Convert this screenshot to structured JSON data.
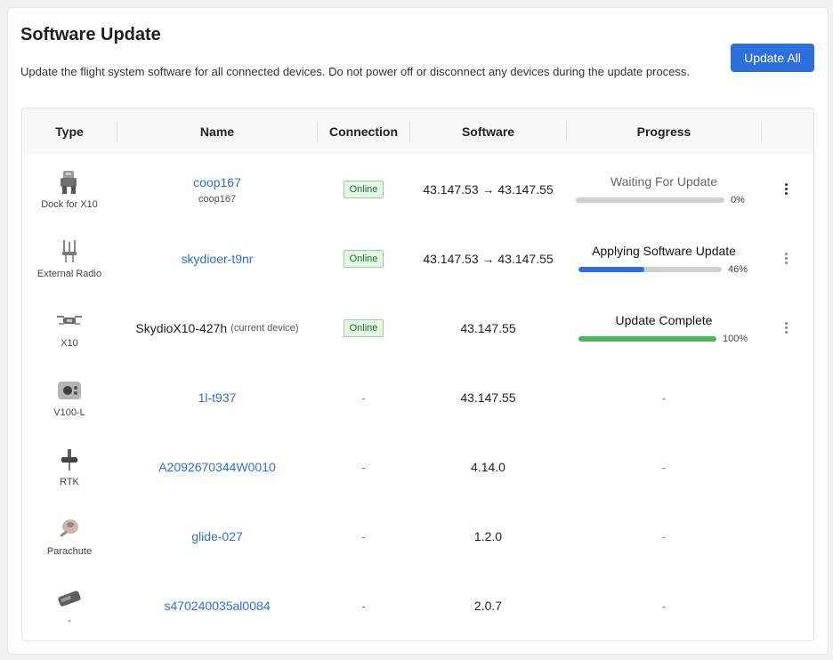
{
  "header": {
    "title": "Software Update",
    "description": "Update the flight system software for all connected devices. Do not power off or disconnect any devices during the update process.",
    "update_all_label": "Update All"
  },
  "columns": [
    "Type",
    "Name",
    "Connection",
    "Software",
    "Progress"
  ],
  "colors": {
    "accent": "#2e6fde",
    "progress_blue": "#2e6fde",
    "progress_green": "#4fb45c",
    "online_bg": "#e6f6e6"
  },
  "rows": [
    {
      "icon": "dock-icon",
      "type": "Dock for X10",
      "name": "coop167",
      "subname": "coop167",
      "connection": "Online",
      "software": "43.147.53 → 43.147.55",
      "progress": {
        "status": "Waiting For Update",
        "percent_label": "0%",
        "percent": 0
      }
    },
    {
      "icon": "radio-icon",
      "type": "External Radio",
      "name": "skydioer-t9nr",
      "connection": "Online",
      "software": "43.147.53 → 43.147.55",
      "progress": {
        "status": "Applying Software Update",
        "percent_label": "46%",
        "percent": 46
      }
    },
    {
      "icon": "drone-icon",
      "type": "X10",
      "name": "SkydioX10-427h",
      "name_note": "(current device)",
      "connection": "Online",
      "software": "43.147.55",
      "progress": {
        "status": "Update Complete",
        "percent_label": "100%",
        "percent": 100
      }
    },
    {
      "icon": "camera-icon",
      "type": "V100-L",
      "name": "1l-t937",
      "connection": "-",
      "software": "43.147.55",
      "progress": {
        "status": "-"
      }
    },
    {
      "icon": "rtk-icon",
      "type": "RTK",
      "name": "A2092670344W0010",
      "connection": "-",
      "software": "4.14.0",
      "progress": {
        "status": "-"
      }
    },
    {
      "icon": "parachute-icon",
      "type": "Parachute",
      "name": "glide-027",
      "connection": "-",
      "software": "1.2.0",
      "progress": {
        "status": "-"
      }
    },
    {
      "icon": "battery-icon",
      "type": "-",
      "name": "s470240035al0084",
      "connection": "-",
      "software": "2.0.7",
      "progress": {
        "status": "-"
      }
    }
  ]
}
